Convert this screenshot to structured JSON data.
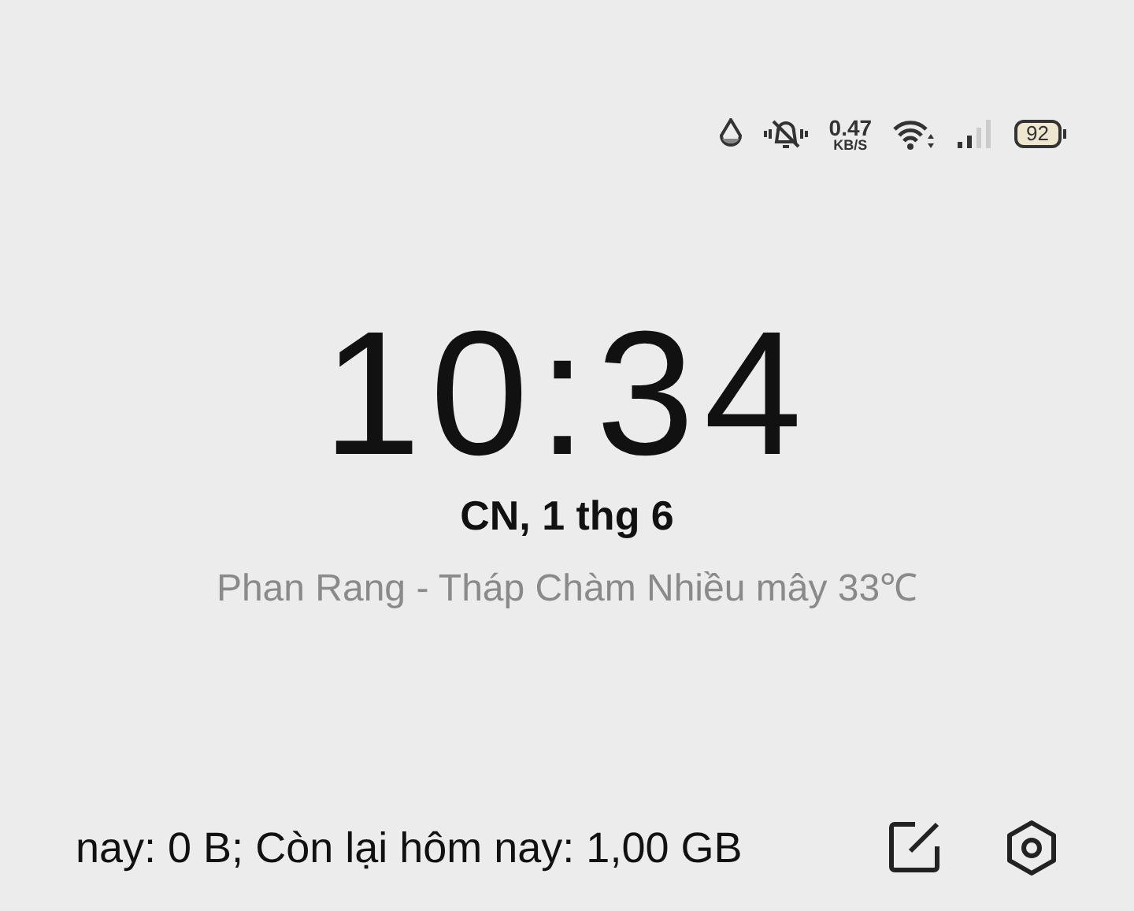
{
  "status_bar": {
    "speed_value": "0.47",
    "speed_unit": "KB/S",
    "battery": "92"
  },
  "clock": {
    "time": "10:34",
    "date": "CN, 1 thg 6",
    "weather": "Phan Rang - Tháp Chàm Nhiều mây 33℃"
  },
  "footer": {
    "data_usage": "nay: 0 B; Còn lại hôm nay: 1,00 GB"
  }
}
